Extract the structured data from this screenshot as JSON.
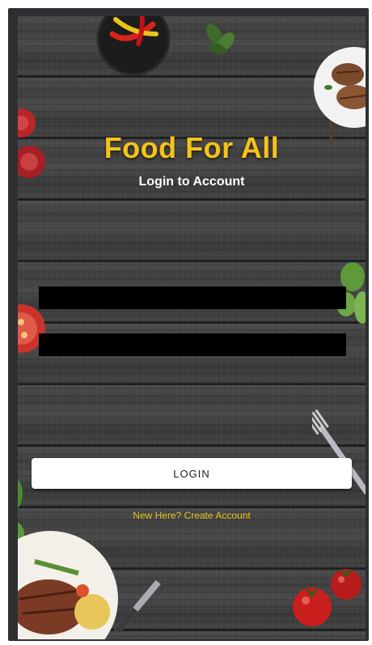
{
  "app": {
    "title": "Food For All",
    "subtitle": "Login to Account"
  },
  "form": {
    "username_value": "",
    "password_value": ""
  },
  "actions": {
    "login_label": "LOGIN",
    "create_account_label": "New Here? Create Account"
  },
  "colors": {
    "title": "#f5c21a",
    "link": "#e8c21c",
    "background": "#3f3f3f",
    "field": "#000000",
    "button": "#ffffff"
  },
  "decorations": [
    "bowl-of-peppers-icon",
    "basil-leaf-icon",
    "grilled-meat-plate-icon",
    "tomato-icon",
    "spinach-leaves-icon",
    "fork-icon",
    "steak-plate-icon",
    "knife-icon",
    "cherry-tomato-icon"
  ]
}
